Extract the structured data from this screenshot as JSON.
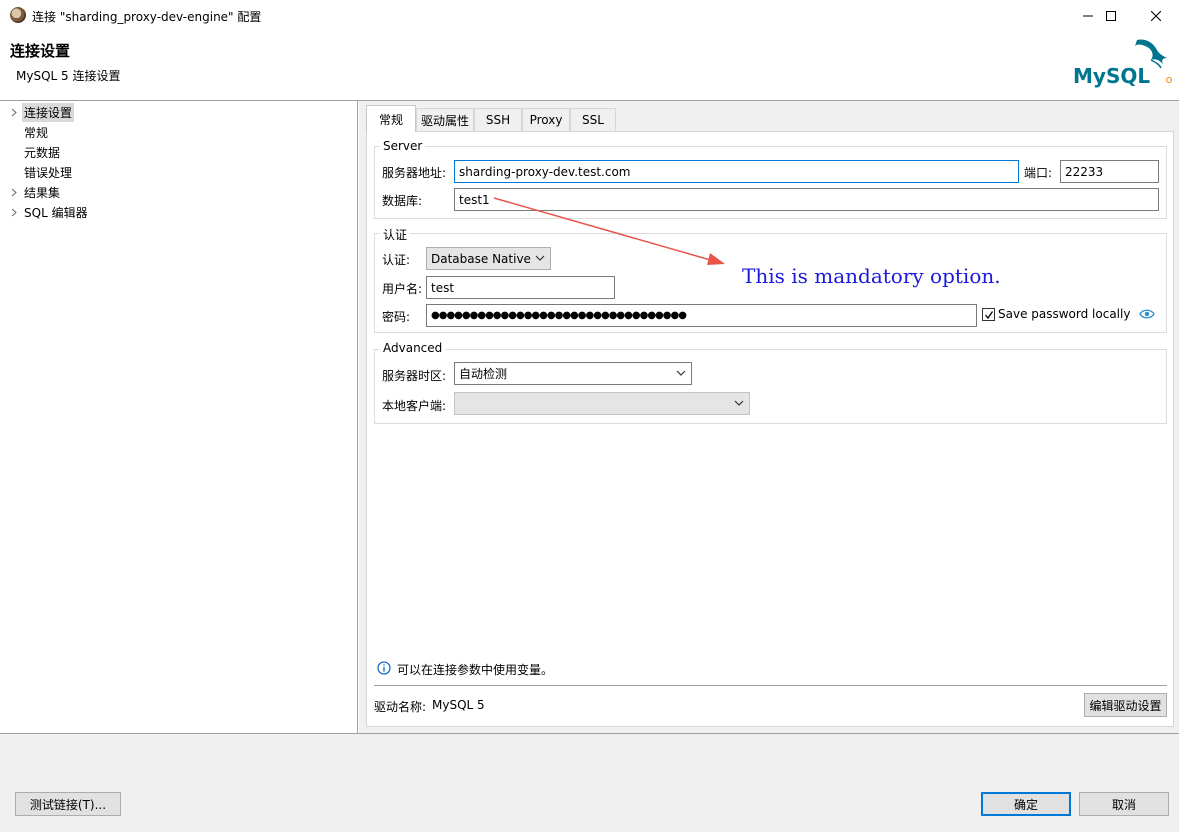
{
  "window": {
    "title": "连接 \"sharding_proxy-dev-engine\" 配置"
  },
  "header": {
    "title": "连接设置",
    "subtitle": "MySQL 5 连接设置",
    "logo_text": "MySQL",
    "logo_color": "#00758F",
    "logo_accent": "#E48E00"
  },
  "tree": {
    "items": [
      {
        "label": "连接设置",
        "expandable": true,
        "selected": true
      },
      {
        "label": "常规",
        "expandable": false
      },
      {
        "label": "元数据",
        "expandable": false
      },
      {
        "label": "错误处理",
        "expandable": false
      },
      {
        "label": "结果集",
        "expandable": true
      },
      {
        "label": "SQL 编辑器",
        "expandable": true
      }
    ]
  },
  "tabs": [
    "常规",
    "驱动属性",
    "SSH",
    "Proxy",
    "SSL"
  ],
  "server": {
    "legend": "Server",
    "host_label": "服务器地址:",
    "host_value": "sharding-proxy-dev.test.com",
    "port_label": "端口:",
    "port_value": "22233",
    "db_label": "数据库:",
    "db_value": "test1"
  },
  "auth": {
    "legend": "认证",
    "auth_label": "认证:",
    "auth_value": "Database Native",
    "user_label": "用户名:",
    "user_value": "test",
    "pass_label": "密码:",
    "pass_value": "●●●●●●●●●●●●●●●●●●●●●●●●●●●●●●●●●",
    "save_password_label": "Save password locally",
    "save_password_checked": true
  },
  "advanced": {
    "legend": "Advanced",
    "timezone_label": "服务器时区:",
    "timezone_value": "自动检测",
    "client_label": "本地客户端:",
    "client_value": ""
  },
  "annotation": {
    "text": "This is mandatory option.",
    "color": "#1a1ad9",
    "arrow_color": "#e8554a"
  },
  "info": {
    "text": "可以在连接参数中使用变量。"
  },
  "driver": {
    "label": "驱动名称:",
    "value": "MySQL 5",
    "edit_button": "编辑驱动设置"
  },
  "footer": {
    "test_button": "测试链接(T)...",
    "ok_button": "确定",
    "cancel_button": "取消"
  }
}
